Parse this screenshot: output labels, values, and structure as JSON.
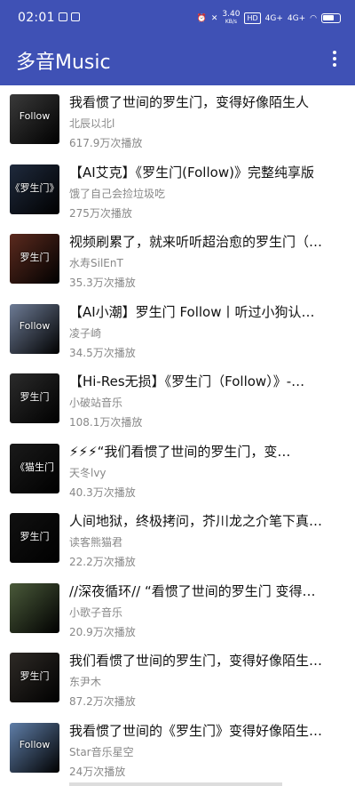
{
  "status_bar": {
    "time": "02:01",
    "speed": "3.40",
    "speed_unit": "KB/s",
    "hd_badge": "HD",
    "signal1": "4G+",
    "signal2": "4G+"
  },
  "app": {
    "title": "多音Music",
    "menu_icon": "more-vert-icon"
  },
  "songs": [
    {
      "title": "我看惯了世间的罗生门，变得好像陌生人",
      "author": "北辰以北l",
      "plays": "617.9万次播放",
      "thumb_text": "Follow",
      "thumb_color": "#3a3a3a"
    },
    {
      "title": "【AI艾克】《罗生门(Follow)》完整纯享版",
      "author": "饿了自己会捡垃圾吃",
      "plays": "275万次播放",
      "thumb_text": "《罗生门》",
      "thumb_color": "#1f2a3d"
    },
    {
      "title": "视频刷累了，就来听听超治愈的罗生门（…",
      "author": "水寿SilEnT",
      "plays": "35.3万次播放",
      "thumb_text": "罗生门",
      "thumb_color": "#5b2a1e"
    },
    {
      "title": "【AI小潮】罗生门 Follow丨听过小狗认…",
      "author": "凌子崎",
      "plays": "34.5万次播放",
      "thumb_text": "Follow",
      "thumb_color": "#6d7b95"
    },
    {
      "title": "【Hi-Res无损】《罗生门（Follow）》-…",
      "author": "小破站音乐",
      "plays": "108.1万次播放",
      "thumb_text": "罗生门",
      "thumb_color": "#2b2b2b"
    },
    {
      "title": "⚡⚡⚡“我们看惯了世间的罗生门，变…",
      "author": "天冬lvy",
      "plays": "40.3万次播放",
      "thumb_text": "《猫生门",
      "thumb_color": "#1a1a1a"
    },
    {
      "title": "人间地狱，终极拷问，芥川龙之介笔下真…",
      "author": "读客熊猫君",
      "plays": "22.2万次播放",
      "thumb_text": "罗生门",
      "thumb_color": "#111111"
    },
    {
      "title": "//深夜循环// “看惯了世间的罗生门 变得…",
      "author": "小歌子音乐",
      "plays": "20.9万次播放",
      "thumb_text": "",
      "thumb_color": "#4a5a3a"
    },
    {
      "title": "我们看惯了世间的罗生门，变得好像陌生…",
      "author": "东尹木",
      "plays": "87.2万次播放",
      "thumb_text": "罗生门",
      "thumb_color": "#2e2a26"
    },
    {
      "title": "我看惯了世间的《罗生门》变得好像陌生…",
      "author": "Star音乐星空",
      "plays": "24万次播放",
      "thumb_text": "Follow",
      "thumb_color": "#5f7ea8"
    }
  ]
}
